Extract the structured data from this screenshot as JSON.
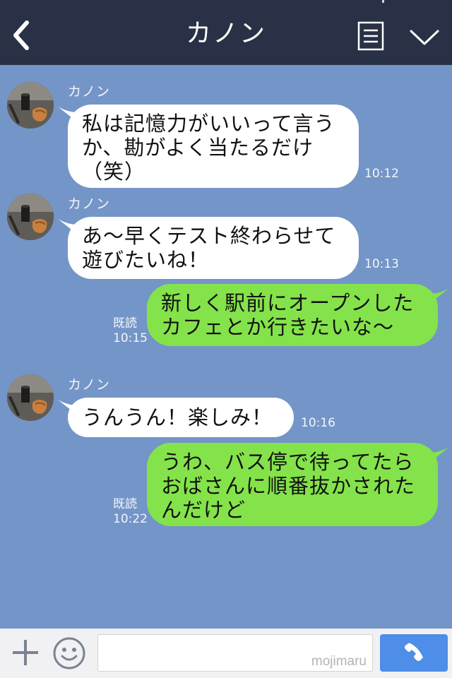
{
  "header": {
    "title": "カノン",
    "back_icon": "chevron-left-icon",
    "menu_icon": "list-icon",
    "more_icon": "chevron-down-icon",
    "background": "#283145"
  },
  "chat": {
    "background": "#7495c7",
    "incoming_bubble_color": "#ffffff",
    "outgoing_bubble_color": "#84e34a",
    "messages": [
      {
        "direction": "incoming",
        "sender": "カノン",
        "text": "私は記憶力がいいって言うか、勘がよく当たるだけ（笑）",
        "time": "10:12"
      },
      {
        "direction": "incoming",
        "sender": "カノン",
        "text": "あ〜早くテスト終わらせて遊びたいね！",
        "time": "10:13"
      },
      {
        "direction": "outgoing",
        "text": "新しく駅前にオープンしたカフェとか行きたいな〜",
        "read": "既読",
        "time": "10:15"
      },
      {
        "direction": "incoming",
        "sender": "カノン",
        "text": "うんうん！楽しみ！",
        "time": "10:16"
      },
      {
        "direction": "outgoing",
        "text": "うわ、バス停で待ってたらおばさんに順番抜かされたんだけど",
        "read": "既読",
        "time": "10:22"
      }
    ]
  },
  "input_bar": {
    "plus_icon": "plus-icon",
    "emoji_icon": "smiley-icon",
    "watermark": "mojimaru",
    "call_icon": "phone-icon",
    "call_button_color": "#4e8de8"
  }
}
